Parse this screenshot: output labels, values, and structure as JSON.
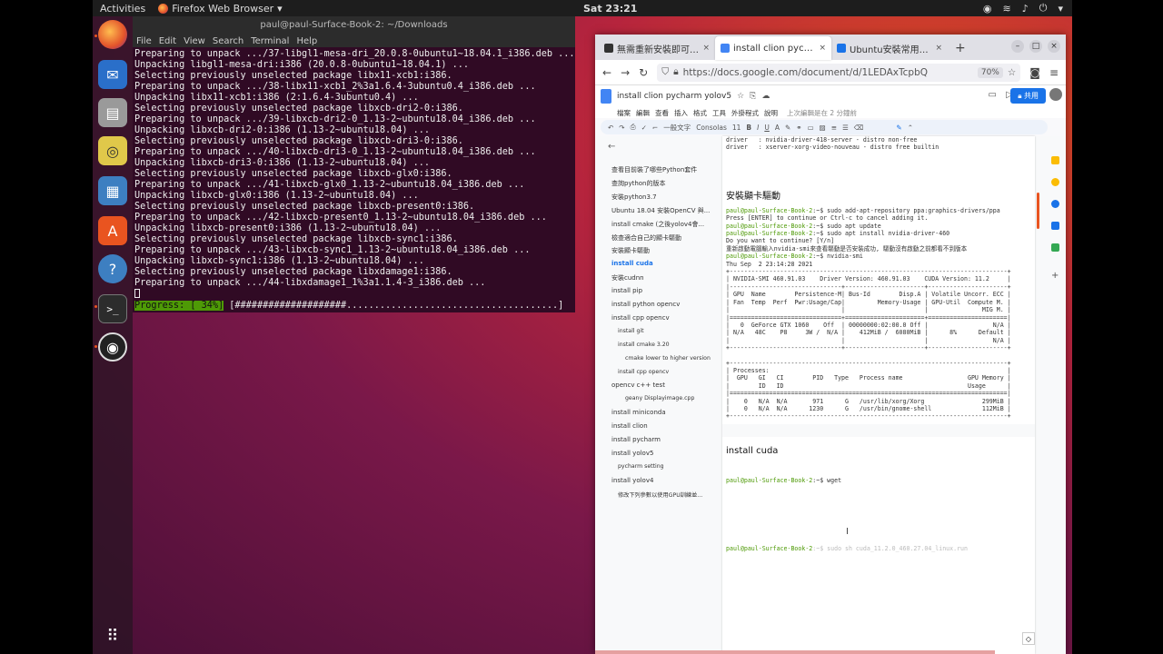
{
  "topbar": {
    "activities": "Activities",
    "app_name": "Firefox Web Browser",
    "clock": "Sat 23:21"
  },
  "terminal": {
    "title": "paul@paul-Surface-Book-2: ~/Downloads",
    "menu": [
      "File",
      "Edit",
      "View",
      "Search",
      "Terminal",
      "Help"
    ],
    "lines": [
      "Preparing to unpack .../37-libgl1-mesa-dri_20.0.8-0ubuntu1~18.04.1_i386.deb ...",
      "Unpacking libgl1-mesa-dri:i386 (20.0.8-0ubuntu1~18.04.1) ...",
      "Selecting previously unselected package libx11-xcb1:i386.",
      "Preparing to unpack .../38-libx11-xcb1_2%3a1.6.4-3ubuntu0.4_i386.deb ...",
      "Unpacking libx11-xcb1:i386 (2:1.6.4-3ubuntu0.4) ...",
      "Selecting previously unselected package libxcb-dri2-0:i386.",
      "Preparing to unpack .../39-libxcb-dri2-0_1.13-2~ubuntu18.04_i386.deb ...",
      "Unpacking libxcb-dri2-0:i386 (1.13-2~ubuntu18.04) ...",
      "Selecting previously unselected package libxcb-dri3-0:i386.",
      "Preparing to unpack .../40-libxcb-dri3-0_1.13-2~ubuntu18.04_i386.deb ...",
      "Unpacking libxcb-dri3-0:i386 (1.13-2~ubuntu18.04) ...",
      "Selecting previously unselected package libxcb-glx0:i386.",
      "Preparing to unpack .../41-libxcb-glx0_1.13-2~ubuntu18.04_i386.deb ...",
      "Unpacking libxcb-glx0:i386 (1.13-2~ubuntu18.04) ...",
      "Selecting previously unselected package libxcb-present0:i386.",
      "Preparing to unpack .../42-libxcb-present0_1.13-2~ubuntu18.04_i386.deb ...",
      "Unpacking libxcb-present0:i386 (1.13-2~ubuntu18.04) ...",
      "Selecting previously unselected package libxcb-sync1:i386.",
      "Preparing to unpack .../43-libxcb-sync1_1.13-2~ubuntu18.04_i386.deb ...",
      "Unpacking libxcb-sync1:i386 (1.13-2~ubuntu18.04) ...",
      "Selecting previously unselected package libxdamage1:i386.",
      "Preparing to unpack .../44-libxdamage1_1%3a1.1.4-3_i386.deb ..."
    ],
    "progress_label": "Progress: [ 34%]",
    "progress_bar": " [####################......................................] "
  },
  "firefox": {
    "tabs": [
      {
        "label": "無需重新安裝即可升級",
        "color": "#333"
      },
      {
        "label": "install clion pycharm",
        "color": "#4285f4"
      },
      {
        "label": "Ubuntu安裝常用的工具",
        "color": "#1a73e8"
      }
    ],
    "new_tab": "+",
    "url": "https://docs.google.com/document/d/1LEDAxTcpbQ",
    "zoom": "70%"
  },
  "docs": {
    "title": "install clion pycharm yolov5",
    "menu": [
      "檔案",
      "編輯",
      "查看",
      "插入",
      "格式",
      "工具",
      "外掛程式",
      "說明"
    ],
    "saved": "上次編輯是在 2 分鐘前",
    "share": "共用",
    "toolbar": [
      "一般文字",
      "Consolas",
      "11"
    ],
    "outline": [
      {
        "label": "查看目前裝了哪些Python套件",
        "level": 1
      },
      {
        "label": "查詢python的版本",
        "level": 1
      },
      {
        "label": "安裝python3.7",
        "level": 1
      },
      {
        "label": "Ubuntu 18.04 安裝OpenCV 與...",
        "level": 1
      },
      {
        "label": "install cmake (之後yolov4會...",
        "level": 1
      },
      {
        "label": "檢查適合自己的顯卡驅動",
        "level": 1
      },
      {
        "label": "安裝顯卡驅動",
        "level": 1
      },
      {
        "label": "install cuda",
        "level": 1,
        "active": true
      },
      {
        "label": "安裝cudnn",
        "level": 1
      },
      {
        "label": "install pip",
        "level": 1
      },
      {
        "label": "install python opencv",
        "level": 1
      },
      {
        "label": "install cpp opencv",
        "level": 1
      },
      {
        "label": "install git",
        "level": 2
      },
      {
        "label": "install cmake 3.20",
        "level": 2
      },
      {
        "label": "cmake lower to higher version",
        "level": 3
      },
      {
        "label": "install cpp opencv",
        "level": 2
      },
      {
        "label": "opencv c++ test",
        "level": 1
      },
      {
        "label": "geany Displayimage.cpp",
        "level": 3
      },
      {
        "label": "install miniconda",
        "level": 1
      },
      {
        "label": "install clion",
        "level": 1
      },
      {
        "label": "install pycharm",
        "level": 1
      },
      {
        "label": "install yolov5",
        "level": 1
      },
      {
        "label": "pycharm setting",
        "level": 2
      },
      {
        "label": "install yolov4",
        "level": 1
      },
      {
        "label": "修改下列參數以使用GPU訓練並...",
        "level": 2
      }
    ],
    "content_top": [
      "driver   : nvidia-driver-418-server - distro non-free",
      "driver   : xserver-xorg-video-nouveau - distro free builtin"
    ],
    "heading1": "安裝顯卡驅動",
    "code1": [
      {
        "p": "paul@paul-Surface-Book-2",
        "t": ":~$ sudo add-apt-repository ppa:graphics-drivers/ppa"
      },
      {
        "p": "",
        "t": "Press [ENTER] to continue or Ctrl-c to cancel adding it."
      },
      {
        "p": "paul@paul-Surface-Book-2",
        "t": ":~$ sudo apt update"
      },
      {
        "p": "paul@paul-Surface-Book-2",
        "t": ":~$ sudo apt install nvidia-driver-460"
      },
      {
        "p": "",
        "t": "Do you want to continue? [Y/n]"
      },
      {
        "p": "",
        "t": "重新啟動電腦輸入nvidia-smi來查看驅動是否安裝成功, 驅動沒有啟動之前都看不到版本"
      },
      {
        "p": "paul@paul-Surface-Book-2",
        "t": ":~$ nvidia-smi"
      },
      {
        "p": "",
        "t": "Thu Sep  2 23:14:28 2021"
      }
    ],
    "smi_table": [
      "+-----------------------------------------------------------------------------+",
      "| NVIDIA-SMI 460.91.03    Driver Version: 460.91.03    CUDA Version: 11.2     |",
      "|-------------------------------+----------------------+----------------------+",
      "| GPU  Name        Persistence-M| Bus-Id        Disp.A | Volatile Uncorr. ECC |",
      "| Fan  Temp  Perf  Pwr:Usage/Cap|         Memory-Usage | GPU-Util  Compute M. |",
      "|                               |                      |               MIG M. |",
      "|===============================+======================+======================|",
      "|   0  GeForce GTX 1060    Off  | 00000000:02:00.0 Off |                  N/A |",
      "| N/A   48C    P8     3W /  N/A |    412MiB /  6080MiB |      8%      Default |",
      "|                               |                      |                  N/A |",
      "+-------------------------------+----------------------+----------------------+",
      "",
      "+-----------------------------------------------------------------------------+",
      "| Processes:                                                                  |",
      "|  GPU   GI   CI        PID   Type   Process name                  GPU Memory |",
      "|        ID   ID                                                   Usage      |",
      "|=============================================================================|",
      "|    0   N/A  N/A       971      G   /usr/lib/xorg/Xorg                299MiB |",
      "|    0   N/A  N/A      1230      G   /usr/bin/gnome-shell              112MiB |",
      "+-----------------------------------------------------------------------------+"
    ],
    "heading2": "install cuda",
    "code2_prompt": "paul@paul-Surface-Book-2",
    "code2_cmd": ":~$ wget",
    "code3_cmd": ":~$ sudo sh cuda_11.2.0_460.27.04_linux.run"
  },
  "colors": {
    "accent": "#e95420",
    "terminal_bg": "#300a24",
    "prompt_green": "#4e9a06",
    "share_blue": "#1a73e8"
  }
}
